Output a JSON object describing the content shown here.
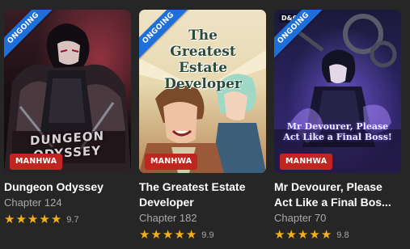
{
  "cards": [
    {
      "status": "ONGOING",
      "type": "MANHWA",
      "cover_text": "DUNGEON ODYSSEY",
      "title": "Dungeon Odyssey",
      "chapter": "Chapter 124",
      "rating": "9.7",
      "stars": 5
    },
    {
      "status": "ONGOING",
      "type": "MANHWA",
      "cover_text": "The Greatest Estate Developer",
      "title": "The Greatest Estate Developer",
      "chapter": "Chapter 182",
      "rating": "9.9",
      "stars": 5
    },
    {
      "status": "ONGOING",
      "type": "MANHWA",
      "cover_text": "Mr Devourer, Please Act Like a Final Boss!",
      "publisher_logo": "D&C",
      "title": "Mr Devourer, Please Act Like a Final Bos...",
      "chapter": "Chapter 70",
      "rating": "9.8",
      "stars": 5
    }
  ],
  "colors": {
    "ribbon": "#1e6fd9",
    "badge": "#c0261f",
    "star": "#f2b01e",
    "muted_text": "#a9a9a9"
  },
  "icons": {
    "star": "star-icon"
  }
}
